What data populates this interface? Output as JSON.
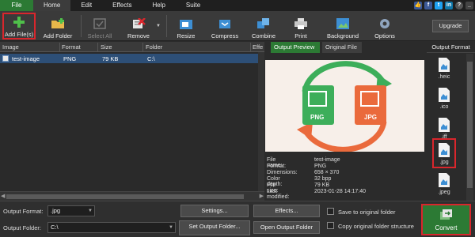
{
  "menu": {
    "tabs": [
      "File",
      "Home",
      "Edit",
      "Effects",
      "Help",
      "Suite"
    ]
  },
  "toolbar": {
    "add_files": "Add File(s)",
    "add_folder": "Add Folder",
    "select_all": "Select All",
    "remove": "Remove",
    "resize": "Resize",
    "compress": "Compress",
    "combine": "Combine",
    "print": "Print",
    "background": "Background",
    "options": "Options",
    "upgrade": "Upgrade"
  },
  "file_list": {
    "columns": [
      "Image",
      "Format",
      "Size",
      "Folder",
      "Effe"
    ],
    "rows": [
      {
        "image": "test-image",
        "format": "PNG",
        "size": "79 KB",
        "folder": "C:\\"
      }
    ]
  },
  "preview": {
    "tab_output": "Output Preview",
    "tab_original": "Original File",
    "badge_left": "PNG",
    "badge_right": "JPG",
    "meta": [
      {
        "key": "File name:",
        "value": "test-image"
      },
      {
        "key": "Format:",
        "value": "PNG"
      },
      {
        "key": "Dimensions:",
        "value": "658 × 370"
      },
      {
        "key": "Color depth:",
        "value": "32 bpp"
      },
      {
        "key": "File size:",
        "value": "79 KB"
      },
      {
        "key": "Last modified:",
        "value": "2023-01-28 14:17:40"
      }
    ]
  },
  "output_formats": {
    "title": "Output Format",
    "items": [
      ".heic",
      ".ico",
      ".iff",
      ".jpg",
      ".jpeg"
    ],
    "selected": ".jpg"
  },
  "bottom": {
    "format_label": "Output Format:",
    "format_value": ".jpg",
    "folder_label": "Output Folder:",
    "folder_value": "C:\\",
    "settings": "Settings...",
    "effects": "Effects...",
    "set_output_folder": "Set Output Folder...",
    "open_output_folder": "Open Output Folder",
    "save_original": "Save to original folder",
    "copy_structure": "Copy original folder structure",
    "convert": "Convert"
  },
  "colors": {
    "accent_green": "#2c7a34",
    "highlight_red": "#d9262c",
    "selection_blue": "#2d4f77"
  }
}
